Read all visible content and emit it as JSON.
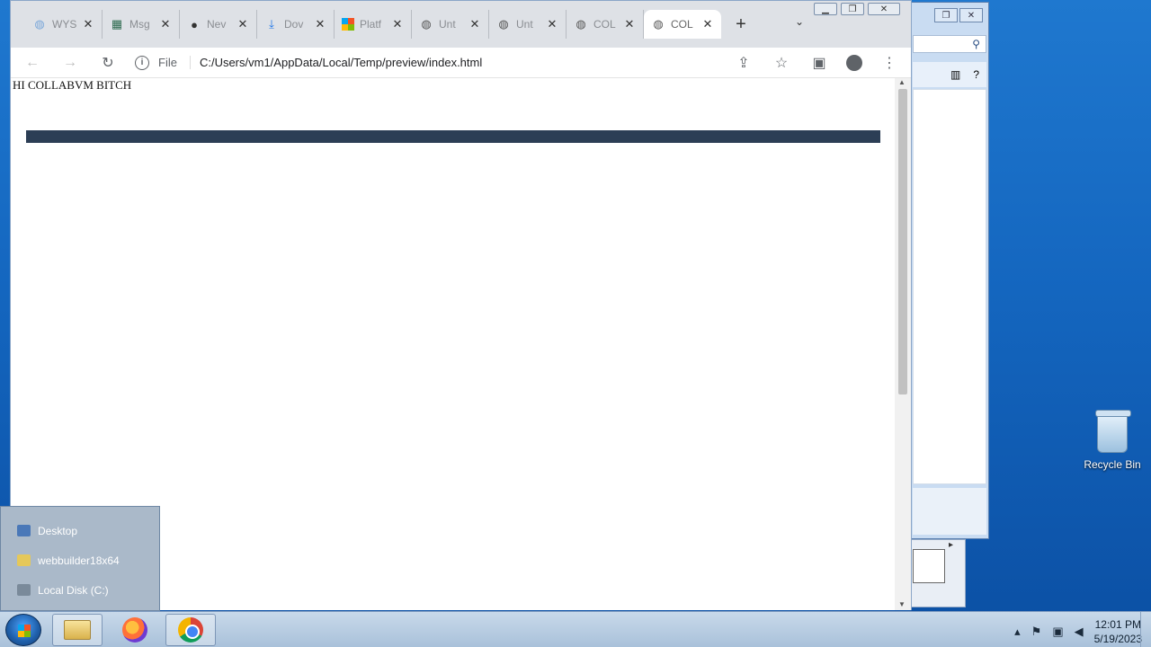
{
  "browser": {
    "tabs": [
      {
        "title": "WYS",
        "icon": "globe-icon",
        "active": false
      },
      {
        "title": "Msg",
        "icon": "table-icon",
        "active": false
      },
      {
        "title": "Nev",
        "icon": "github-icon",
        "active": false
      },
      {
        "title": "Dov",
        "icon": "download-icon",
        "active": false
      },
      {
        "title": "Platf",
        "icon": "windows-logo-icon",
        "active": false
      },
      {
        "title": "Unt",
        "icon": "globe-icon",
        "active": false
      },
      {
        "title": "Unt",
        "icon": "globe-icon",
        "active": false
      },
      {
        "title": "COL",
        "icon": "globe-icon",
        "active": false
      },
      {
        "title": "COL",
        "icon": "globe-icon",
        "active": true
      }
    ],
    "new_tab": "+",
    "tab_search": "⌄",
    "address": {
      "scheme": "File",
      "url": "C:/Users/vm1/AppData/Local/Temp/preview/index.html"
    },
    "page": {
      "text": "HI COLLABVM BITCH"
    }
  },
  "jumplist": {
    "items": [
      {
        "label": "Desktop",
        "color": "#4a78b8"
      },
      {
        "label": "webbuilder18x64",
        "color": "#e5c85a"
      },
      {
        "label": "Local Disk (C:)",
        "color": "#7a8a9a"
      }
    ]
  },
  "desktop": {
    "recycle_bin": "Recycle Bin"
  },
  "taskbar": {
    "clock_time": "12:01 PM",
    "clock_date": "5/19/2023"
  },
  "colors": {
    "page_bar": "#2c3e55",
    "desktop_bg": "#1466bf"
  }
}
